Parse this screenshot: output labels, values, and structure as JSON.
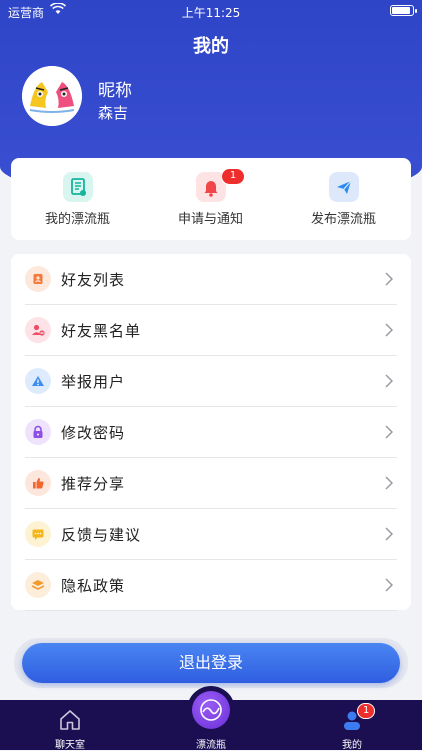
{
  "status_bar": {
    "carrier": "运营商",
    "time": "上午11:25"
  },
  "header": {
    "title": "我的"
  },
  "profile": {
    "nickname_label": "昵称",
    "nickname": "森吉"
  },
  "quick_actions": [
    {
      "label": "我的漂流瓶",
      "icon": "document-icon",
      "color": "#16b39e"
    },
    {
      "label": "申请与通知",
      "icon": "bell-icon",
      "color": "#f0474a",
      "badge": "1"
    },
    {
      "label": "发布漂流瓶",
      "icon": "send-icon",
      "color": "#2d8cf0"
    }
  ],
  "menu": [
    {
      "label": "好友列表",
      "icon": "contact-card-icon",
      "color": "#f47a3c"
    },
    {
      "label": "好友黑名单",
      "icon": "users-blocked-icon",
      "color": "#ec4f68"
    },
    {
      "label": "举报用户",
      "icon": "warning-triangle-icon",
      "color": "#3d8ef0"
    },
    {
      "label": "修改密码",
      "icon": "lock-icon",
      "color": "#8e4ee8"
    },
    {
      "label": "推荐分享",
      "icon": "thumbs-up-icon",
      "color": "#f2672f"
    },
    {
      "label": "反馈与建议",
      "icon": "chat-icon",
      "color": "#f3b71c"
    },
    {
      "label": "隐私政策",
      "icon": "layers-icon",
      "color": "#f39a2d"
    }
  ],
  "logout": {
    "label": "退出登录"
  },
  "tabbar": {
    "tabs": [
      {
        "label": "聊天室",
        "icon": "home-icon"
      },
      {
        "label": "漂流瓶",
        "icon": "bottle-icon"
      },
      {
        "label": "我的",
        "icon": "person-icon",
        "badge": "1"
      }
    ]
  },
  "colors": {
    "primary": "#3048c8",
    "tabbar": "#1b0f52",
    "badge": "#ee2d2d"
  }
}
